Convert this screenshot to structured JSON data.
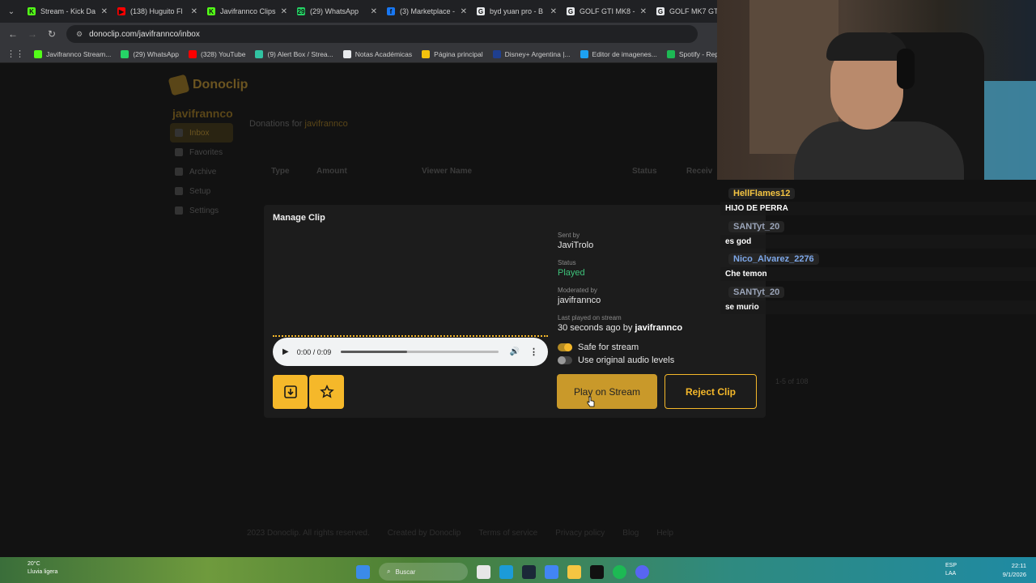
{
  "browser": {
    "tabs": [
      {
        "title": "Stream - Kick Da",
        "color": "#53fc18",
        "glyph": "K"
      },
      {
        "title": "(138) Huguito Fl",
        "color": "#ff0000",
        "glyph": "▶"
      },
      {
        "title": "Javifrannco Clips",
        "color": "#53fc18",
        "glyph": "K"
      },
      {
        "title": "(29) WhatsApp",
        "color": "#25d366",
        "glyph": "29"
      },
      {
        "title": "(3) Marketplace -",
        "color": "#1877f2",
        "glyph": "f"
      },
      {
        "title": "byd yuan pro - B",
        "color": "#e8eaed",
        "glyph": "G"
      },
      {
        "title": "GOLF GTI MK8 -",
        "color": "#e8eaed",
        "glyph": "G"
      },
      {
        "title": "GOLF MK7 GTI -",
        "color": "#e8eaed",
        "glyph": "G"
      }
    ],
    "url": "donoclip.com/javifrannco/inbox",
    "bookmarks": [
      {
        "label": "Javifrannco Stream...",
        "color": "#53fc18"
      },
      {
        "label": "(29) WhatsApp",
        "color": "#25d366"
      },
      {
        "label": "(328) YouTube",
        "color": "#ff0000"
      },
      {
        "label": "(9) Alert Box / Strea...",
        "color": "#31c3a2"
      },
      {
        "label": "Notas Académicas",
        "color": "#e8eaed"
      },
      {
        "label": "Página principal",
        "color": "#f4c20d"
      },
      {
        "label": "Disney+ Argentina |...",
        "color": "#1f3f8f"
      },
      {
        "label": "Editor de imagenes...",
        "color": "#1da1f2"
      },
      {
        "label": "Spotify - Reproduct...",
        "color": "#1db954"
      }
    ]
  },
  "background_page": {
    "logo": "Donoclip",
    "username": "javifrannco",
    "nav": [
      "Inbox",
      "Favorites",
      "Archive",
      "Setup",
      "Settings"
    ],
    "title_prefix": "Donations for",
    "title_user": "javifrannco",
    "columns": [
      "Type",
      "Amount",
      "Viewer Name",
      "Status",
      "Receiv"
    ],
    "pagination": "1-5 of 108",
    "footer": [
      "2023 Donoclip. All rights reserved.",
      "Created by Donoclip",
      "Terms of service",
      "Privacy policy",
      "Blog",
      "Help"
    ]
  },
  "modal": {
    "title": "Manage Clip",
    "audio": {
      "time": "0:00 / 0:09",
      "progress": 0.42
    },
    "sent_by_label": "Sent by",
    "sent_by": "JaviTrolo",
    "status_label": "Status",
    "status": "Played",
    "moderated_by_label": "Moderated by",
    "moderated_by": "javifrannco",
    "last_played_label": "Last played on stream",
    "last_played_prefix": "30 seconds ago by",
    "last_played_user": "javifrannco",
    "safe_label": "Safe for stream",
    "original_audio_label": "Use original audio levels",
    "play_button": "Play on Stream",
    "reject_button": "Reject Clip",
    "accent": "#f5b82a",
    "played_color": "#3ec27a"
  },
  "chat": [
    {
      "name": "HellFlames12",
      "color": "#f5c542",
      "text": "HIJO DE PERRA"
    },
    {
      "name": "SANTyt_20",
      "color": "#9aa4b8",
      "text": "es god"
    },
    {
      "name": "Nico_Alvarez_2276",
      "color": "#7da7e8",
      "text": "Che temon"
    },
    {
      "name": "SANTyt_20",
      "color": "#9aa4b8",
      "text": "se murio"
    }
  ],
  "taskbar": {
    "weather_temp": "20°C",
    "weather_desc": "Lluvia ligera",
    "search": "Buscar",
    "lang": "ESP",
    "lang2": "LAA",
    "time": "22:11",
    "date": "9/1/2026"
  }
}
